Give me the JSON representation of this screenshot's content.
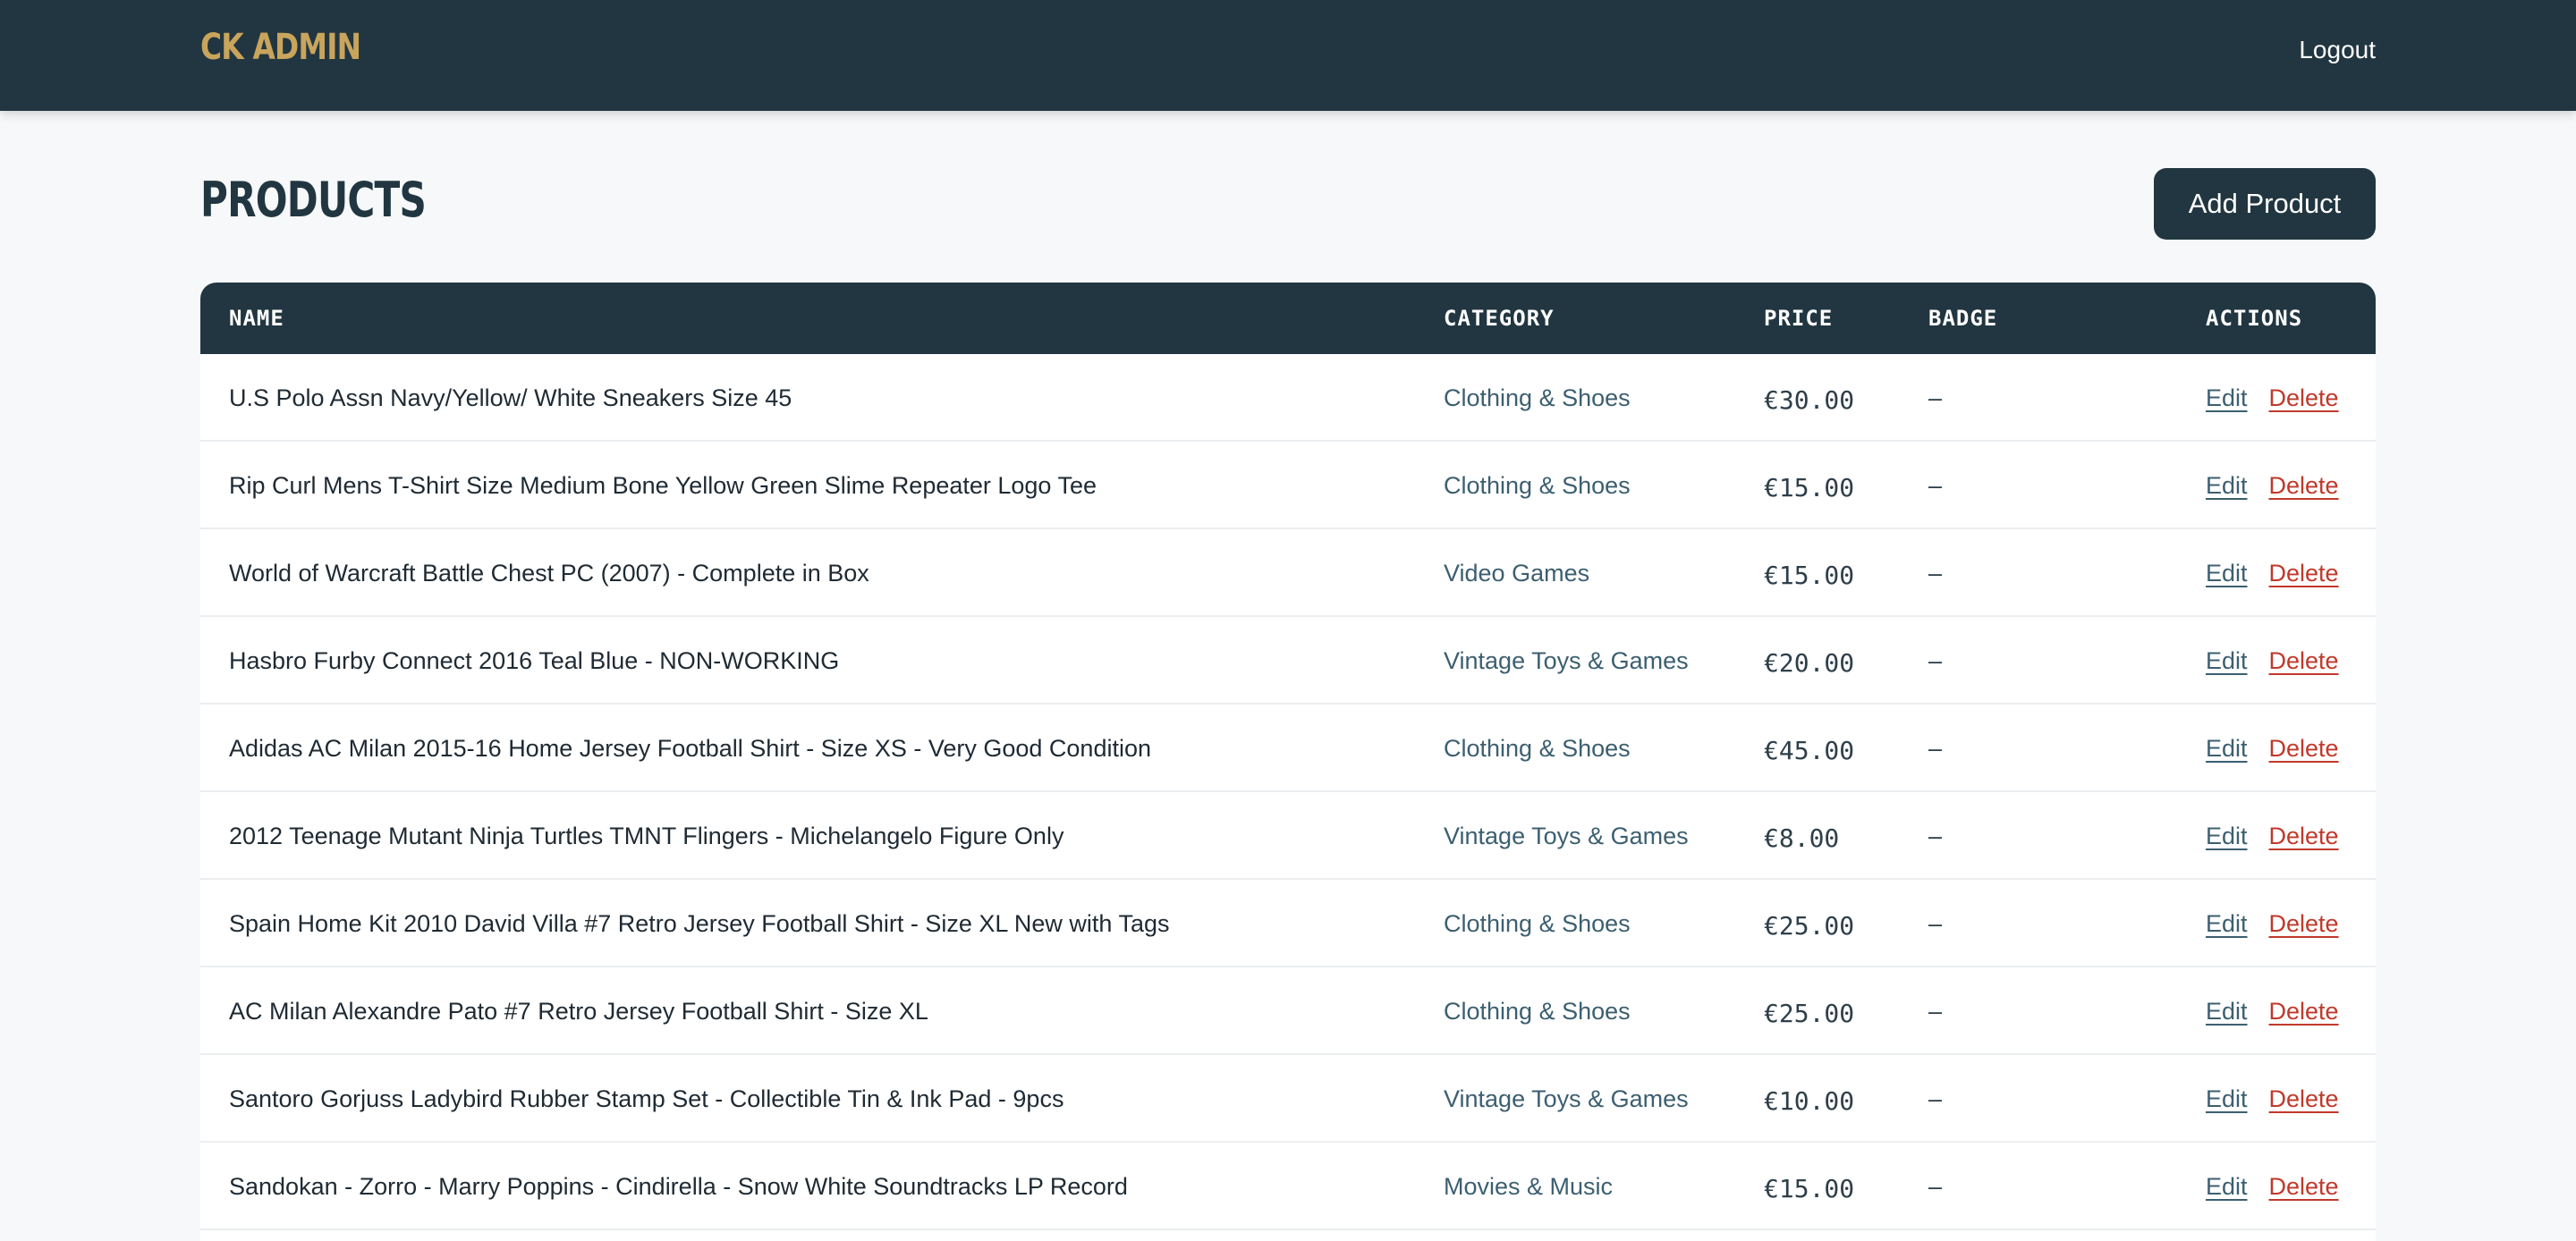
{
  "header": {
    "brand": "CK ADMIN",
    "logout_label": "Logout"
  },
  "page": {
    "title": "PRODUCTS",
    "add_button_label": "Add Product"
  },
  "table": {
    "columns": [
      "NAME",
      "CATEGORY",
      "PRICE",
      "BADGE",
      "ACTIONS"
    ],
    "edit_label": "Edit",
    "delete_label": "Delete",
    "rows": [
      {
        "name": "U.S Polo Assn Navy/Yellow/ White Sneakers Size 45",
        "category": "Clothing & Shoes",
        "price": "€30.00",
        "badge": "–"
      },
      {
        "name": "Rip Curl Mens T-Shirt Size Medium Bone Yellow Green Slime Repeater Logo Tee",
        "category": "Clothing & Shoes",
        "price": "€15.00",
        "badge": "–"
      },
      {
        "name": "World of Warcraft Battle Chest PC (2007) - Complete in Box",
        "category": "Video Games",
        "price": "€15.00",
        "badge": "–"
      },
      {
        "name": "Hasbro Furby Connect 2016 Teal Blue - NON-WORKING",
        "category": "Vintage Toys & Games",
        "price": "€20.00",
        "badge": "–"
      },
      {
        "name": "Adidas AC Milan 2015-16 Home Jersey Football Shirt - Size XS - Very Good Condition",
        "category": "Clothing & Shoes",
        "price": "€45.00",
        "badge": "–"
      },
      {
        "name": "2012 Teenage Mutant Ninja Turtles TMNT Flingers - Michelangelo Figure Only",
        "category": "Vintage Toys & Games",
        "price": "€8.00",
        "badge": "–"
      },
      {
        "name": "Spain Home Kit 2010 David Villa #7 Retro Jersey Football Shirt - Size XL New with Tags",
        "category": "Clothing & Shoes",
        "price": "€25.00",
        "badge": "–"
      },
      {
        "name": "AC Milan Alexandre Pato #7 Retro Jersey Football Shirt - Size XL",
        "category": "Clothing & Shoes",
        "price": "€25.00",
        "badge": "–"
      },
      {
        "name": "Santoro Gorjuss Ladybird Rubber Stamp Set - Collectible Tin & Ink Pad - 9pcs",
        "category": "Vintage Toys & Games",
        "price": "€10.00",
        "badge": "–"
      },
      {
        "name": "Sandokan - Zorro - Marry Poppins - Cindirella - Snow White Soundtracks LP Record",
        "category": "Movies & Music",
        "price": "€15.00",
        "badge": "–"
      }
    ]
  },
  "colors": {
    "header_bg": "#213640",
    "brand": "#c9a45c",
    "page_bg": "#f6f8f9",
    "link": "#3c5f70",
    "delete": "#c0392b"
  }
}
